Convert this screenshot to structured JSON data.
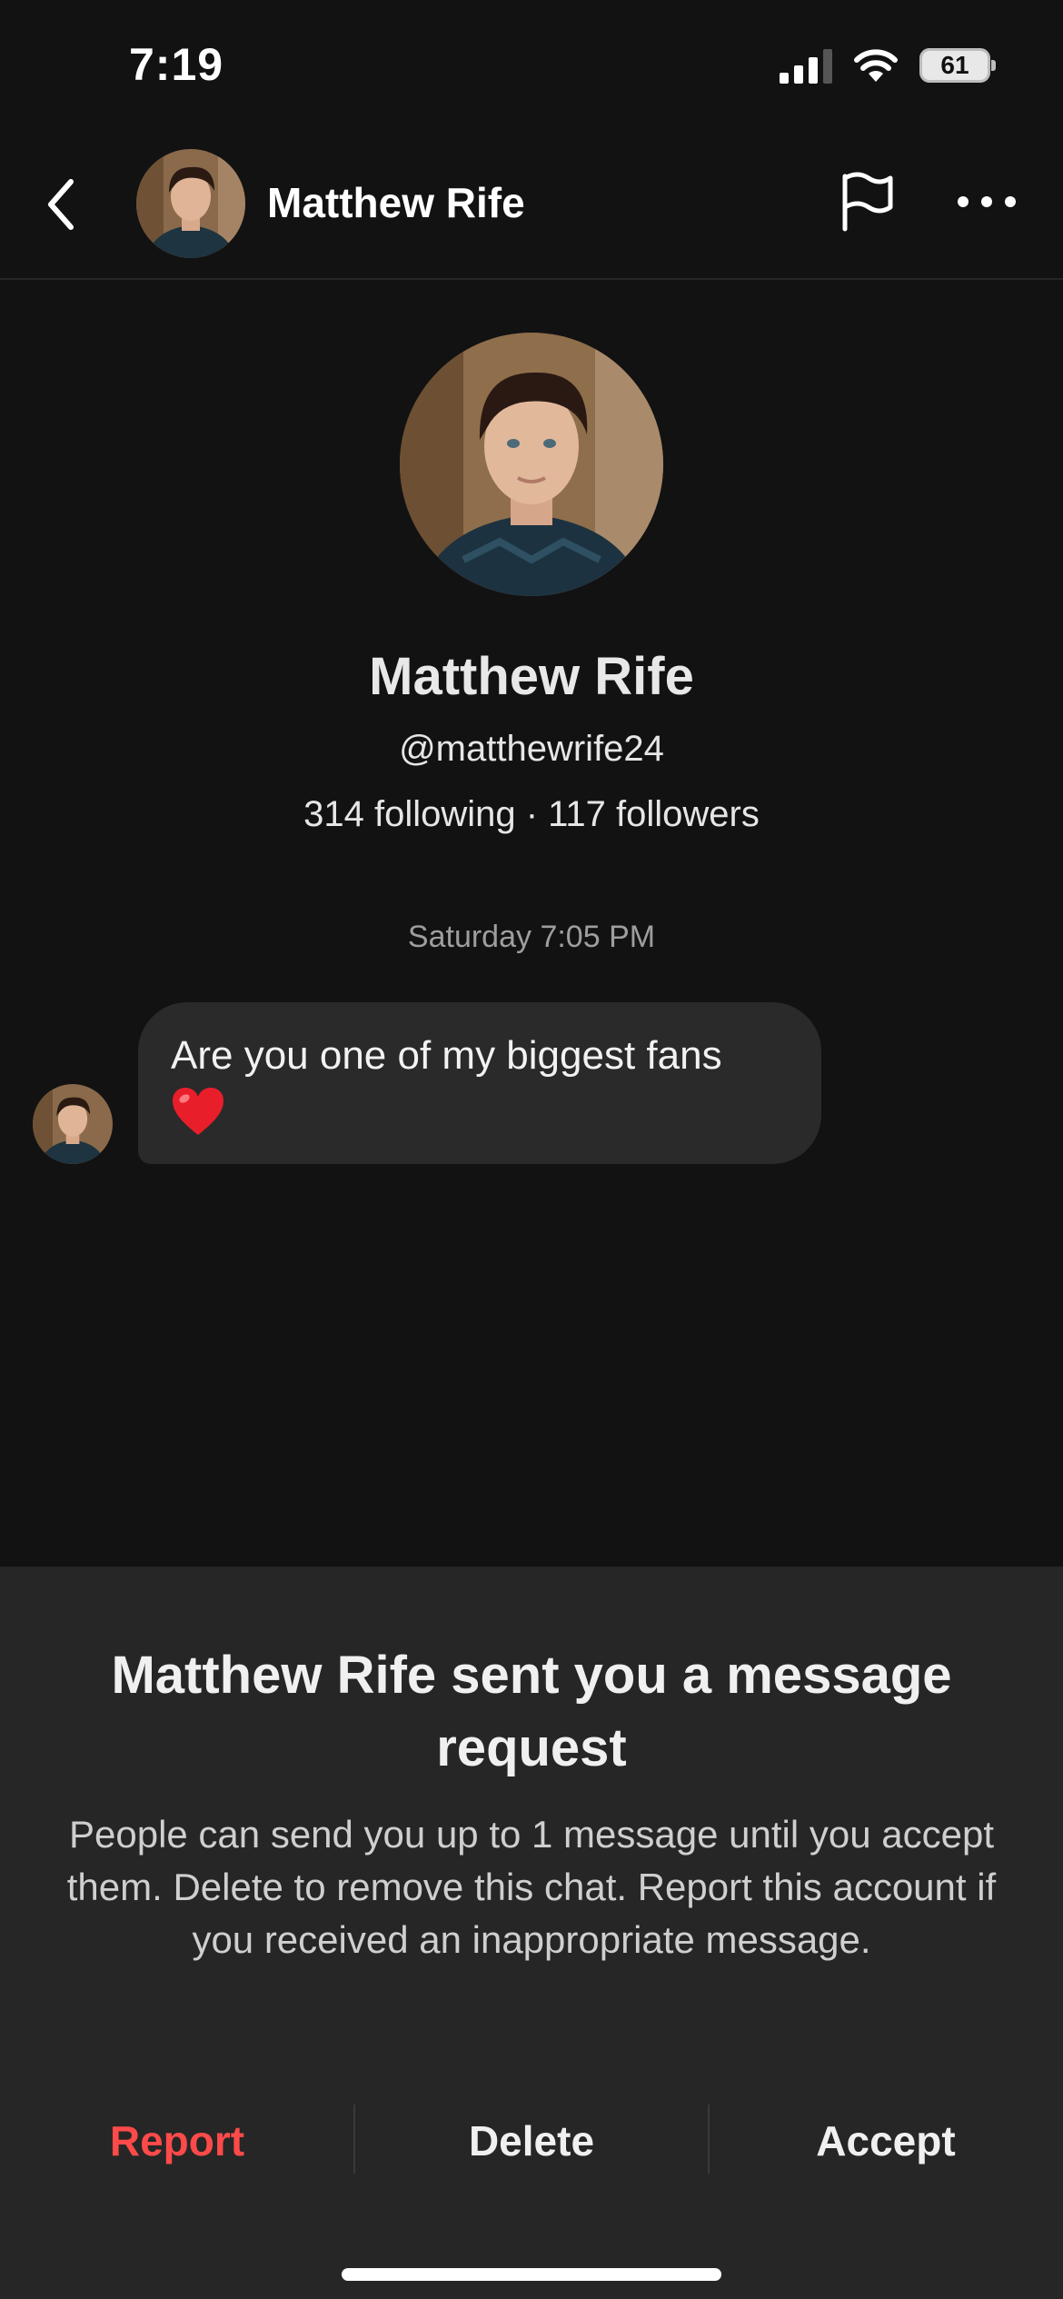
{
  "status_bar": {
    "time": "7:19",
    "battery": "61"
  },
  "header": {
    "name": "Matthew Rife"
  },
  "profile": {
    "name": "Matthew Rife",
    "handle": "@matthewrife24",
    "counts": "314 following · 117 followers"
  },
  "conversation": {
    "timestamp": "Saturday 7:05 PM",
    "message_text": "Are you one of my biggest fans"
  },
  "request_sheet": {
    "title": "Matthew Rife sent you a message request",
    "body": "People can send you up to 1 message until you accept them. Delete to remove this chat. Report this account if you received an inappropriate message.",
    "report_label": "Report",
    "delete_label": "Delete",
    "accept_label": "Accept"
  },
  "colors": {
    "background": "#121212",
    "sheet": "#262626",
    "bubble": "#2a2a2a",
    "report": "#ff4a4a"
  }
}
